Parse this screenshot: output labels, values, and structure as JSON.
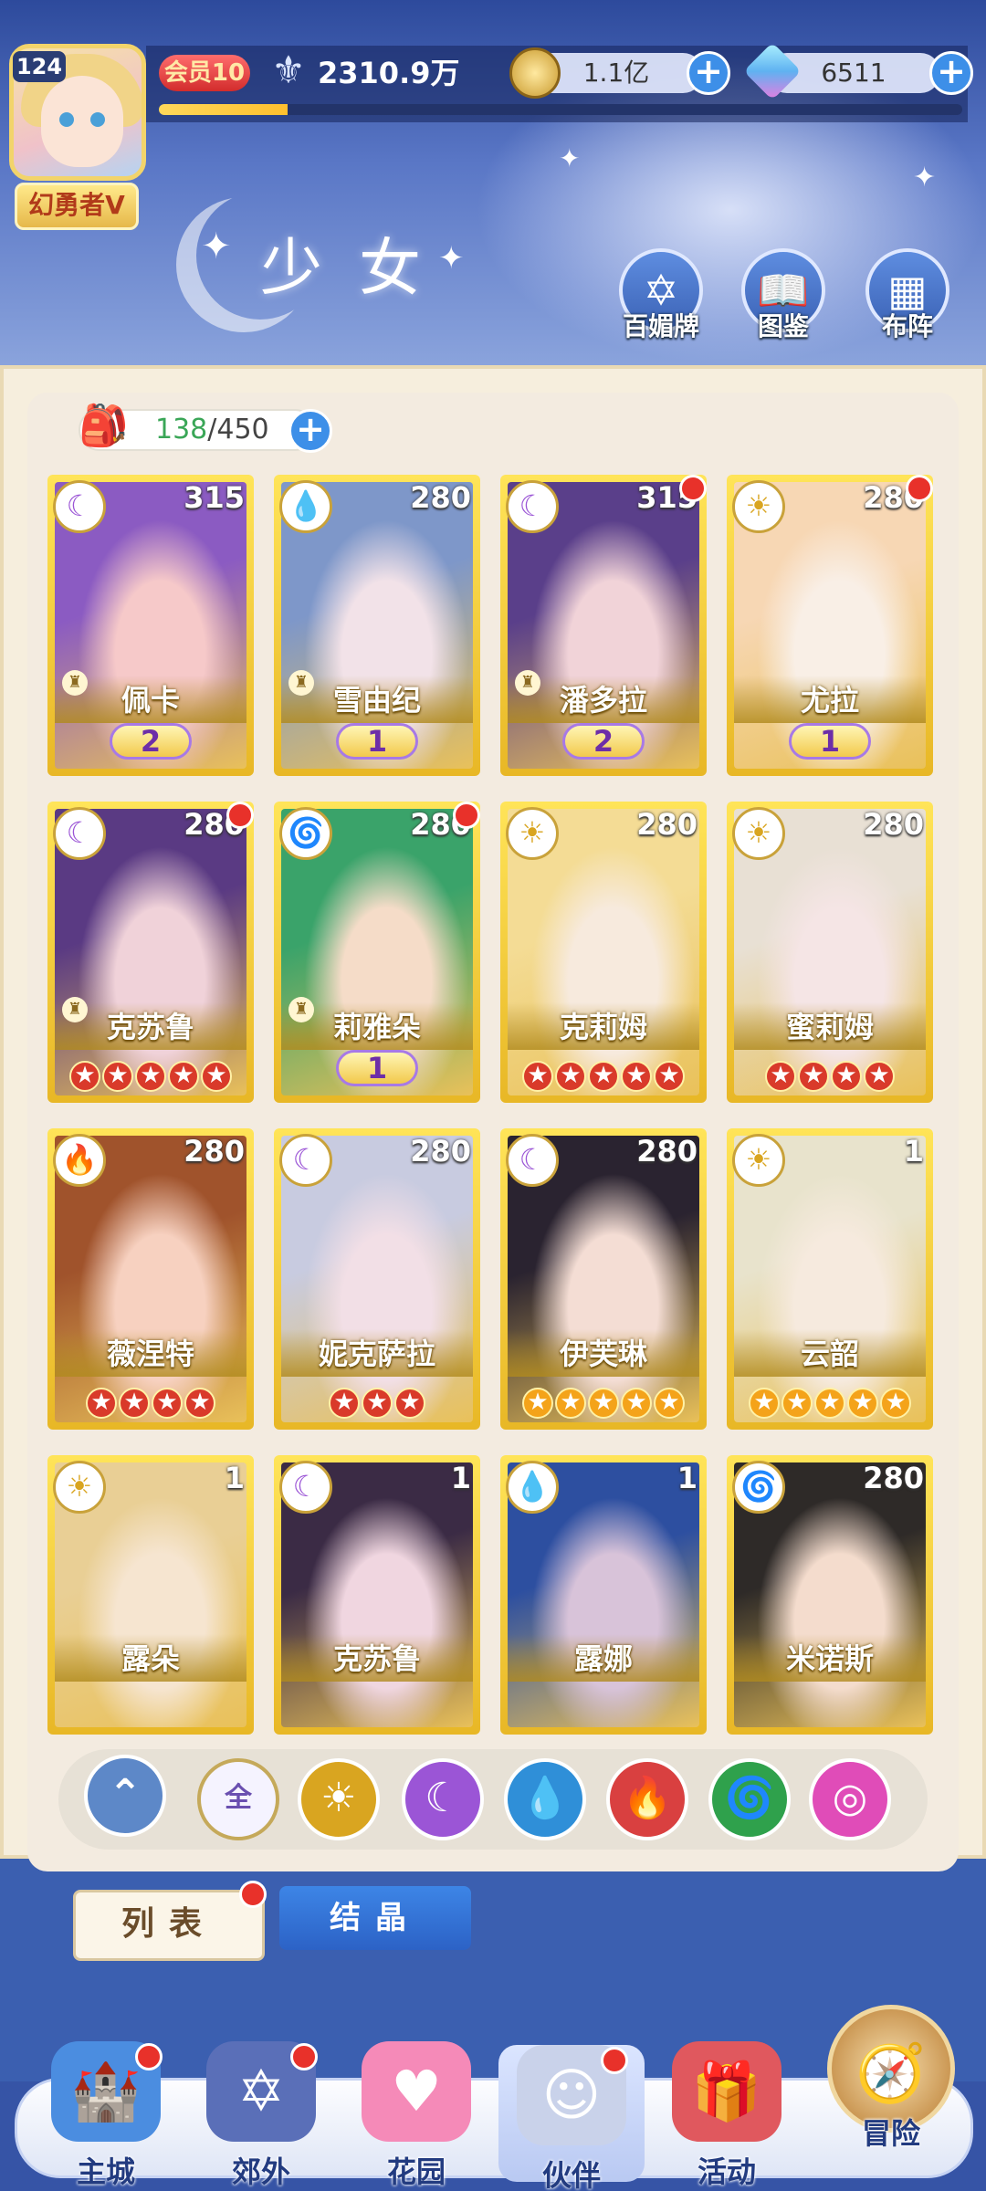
{
  "player": {
    "level": "124",
    "title": "幻勇者V",
    "vip": "会员10",
    "power": "2310.9万",
    "xp_progress": 0.16
  },
  "resources": [
    {
      "name": "gold-coin",
      "value": "1.1亿"
    },
    {
      "name": "diamond",
      "value": "6511"
    }
  ],
  "page_title": "少女",
  "top_buttons": [
    {
      "label": "百媚牌",
      "icon": "star-of-david-icon"
    },
    {
      "label": "图鉴",
      "icon": "book-icon"
    },
    {
      "label": "布阵",
      "icon": "grid-icon"
    }
  ],
  "roster": {
    "owned": "138",
    "capacity": "/450"
  },
  "cards": [
    {
      "name": "佩卡",
      "level": "315",
      "element": "moon",
      "rank": "2",
      "dot": false,
      "chess": true
    },
    {
      "name": "雪由纪",
      "level": "280",
      "element": "water",
      "rank": "1",
      "dot": false,
      "chess": true
    },
    {
      "name": "潘多拉",
      "level": "315",
      "element": "moon",
      "rank": "2",
      "dot": true,
      "chess": true
    },
    {
      "name": "尤拉",
      "level": "280",
      "element": "sun",
      "rank": "1",
      "dot": true,
      "chess": false
    },
    {
      "name": "克苏鲁",
      "level": "280",
      "element": "moon",
      "stars": 5,
      "star_color": "red",
      "dot": true,
      "chess": true
    },
    {
      "name": "莉雅朵",
      "level": "280",
      "element": "wind",
      "rank": "1",
      "dot": true,
      "chess": true
    },
    {
      "name": "克莉姆",
      "level": "280",
      "element": "sun",
      "stars": 5,
      "star_color": "red",
      "dot": false,
      "chess": false
    },
    {
      "name": "蜜莉姆",
      "level": "280",
      "element": "sun",
      "stars": 4,
      "star_color": "red",
      "dot": false,
      "chess": false
    },
    {
      "name": "薇涅特",
      "level": "280",
      "element": "fire",
      "stars": 4,
      "star_color": "red",
      "dot": false,
      "chess": false
    },
    {
      "name": "妮克萨拉",
      "level": "280",
      "element": "moon",
      "stars": 3,
      "star_color": "red",
      "dot": false,
      "chess": false
    },
    {
      "name": "伊芙琳",
      "level": "280",
      "element": "moon",
      "stars": 5,
      "star_color": "gold",
      "dot": false,
      "chess": false
    },
    {
      "name": "云韶",
      "level": "1",
      "element": "sun",
      "stars": 5,
      "star_color": "gold",
      "dot": false,
      "chess": false
    },
    {
      "name": "露朵",
      "level": "1",
      "element": "sun",
      "dot": false,
      "chess": false
    },
    {
      "name": "克苏鲁",
      "level": "1",
      "element": "moon",
      "dot": false,
      "chess": false
    },
    {
      "name": "露娜",
      "level": "1",
      "element": "water",
      "dot": false,
      "chess": false
    },
    {
      "name": "米诺斯",
      "level": "280",
      "element": "wind",
      "dot": false,
      "chess": false
    }
  ],
  "filters": [
    {
      "name": "collapse",
      "glyph": "⌃",
      "color": "#5d88c8"
    },
    {
      "name": "all",
      "glyph": "全",
      "color": "#ffffff"
    },
    {
      "name": "sun",
      "glyph": "☀",
      "color": "#d9a520"
    },
    {
      "name": "moon",
      "glyph": "☾",
      "color": "#9b55d6"
    },
    {
      "name": "water",
      "glyph": "💧",
      "color": "#2f8fd8"
    },
    {
      "name": "fire",
      "glyph": "🔥",
      "color": "#d94040"
    },
    {
      "name": "wind",
      "glyph": "🌀",
      "color": "#2fa14c"
    },
    {
      "name": "arcane",
      "glyph": "◎",
      "color": "#e04cb8"
    }
  ],
  "tabs": {
    "list": "列表",
    "crystal": "结晶"
  },
  "nav": [
    {
      "label": "主城",
      "icon": "castle-icon",
      "dot": true
    },
    {
      "label": "郊外",
      "icon": "portal-icon",
      "dot": true
    },
    {
      "label": "花园",
      "icon": "heart-icon",
      "dot": false
    },
    {
      "label": "伙伴",
      "icon": "partner-icon",
      "dot": true
    },
    {
      "label": "活动",
      "icon": "gift-icon",
      "dot": false
    },
    {
      "label": "冒险",
      "icon": "compass-icon",
      "dot": false
    }
  ],
  "element_colors": {
    "moon": "#9b55d6",
    "water": "#2f8fd8",
    "sun": "#d9a520",
    "wind": "#2fa14c",
    "fire": "#d94040"
  },
  "element_glyphs": {
    "moon": "☾",
    "water": "💧",
    "sun": "☀",
    "wind": "🌀",
    "fire": "🔥"
  }
}
